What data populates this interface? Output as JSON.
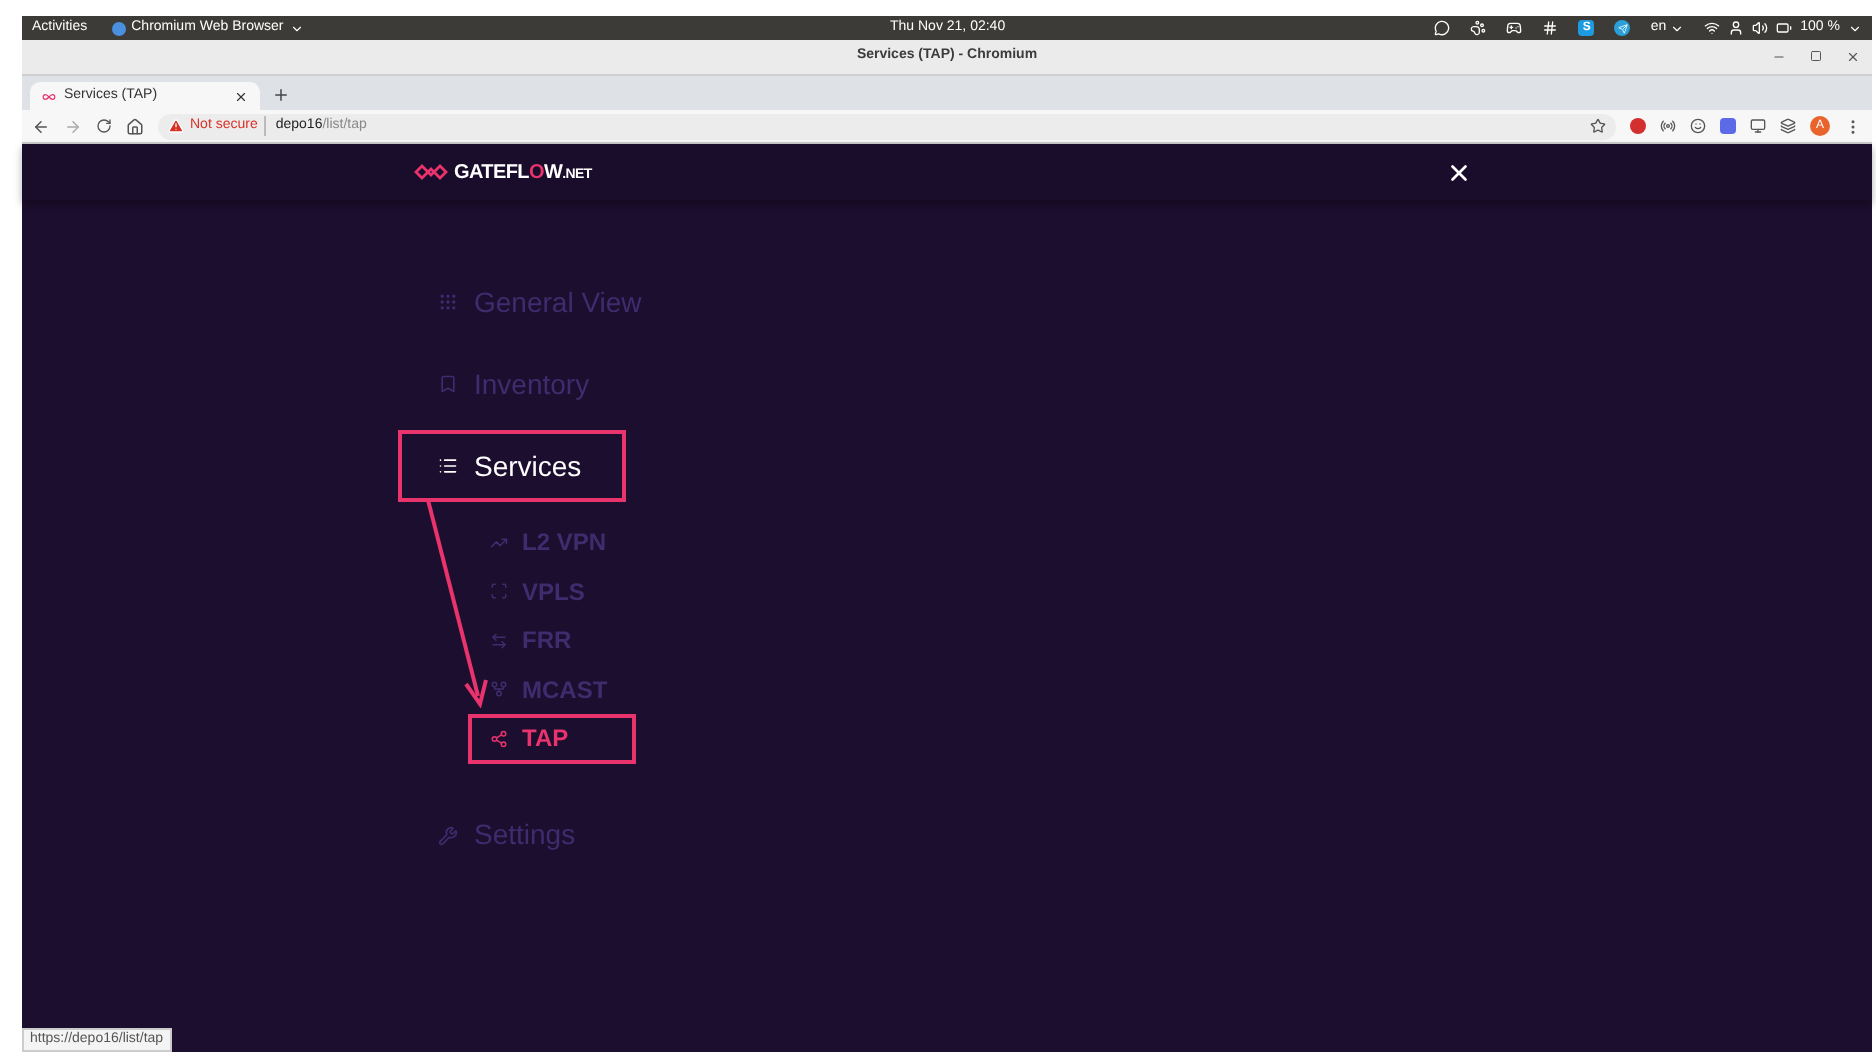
{
  "top_bar": {
    "activities": "Activities",
    "app_menu": "Chromium Web Browser",
    "clock": "Thu Nov 21, 02:40",
    "skype_letter": "S",
    "keyboard": "en",
    "battery": "100 %"
  },
  "window": {
    "title": "Services (TAP) - Chromium"
  },
  "tabs": [
    {
      "label": "Services (TAP)",
      "selected": true
    }
  ],
  "address_bar": {
    "security": "Not secure",
    "host": "depo16",
    "path": "/list/tap",
    "profile_letter": "A"
  },
  "app": {
    "logo": [
      {
        "text": "GATEFL",
        "accent": false,
        "small": false
      },
      {
        "text": "O",
        "accent": true,
        "small": false
      },
      {
        "text": "W",
        "accent": false,
        "small": false
      },
      {
        "text": ".NET",
        "accent": false,
        "small": true
      }
    ],
    "menu": [
      {
        "label": "General View",
        "selected": false,
        "annotated": false
      },
      {
        "label": "Inventory",
        "selected": false,
        "annotated": false
      },
      {
        "label": "Services",
        "selected": true,
        "annotated": true,
        "expanded": true,
        "children": [
          {
            "label": "L2 VPN",
            "selected": false,
            "annotated": false
          },
          {
            "label": "VPLS",
            "selected": false,
            "annotated": false
          },
          {
            "label": "FRR",
            "selected": false,
            "annotated": false
          },
          {
            "label": "MCAST",
            "selected": false,
            "annotated": false
          },
          {
            "label": "TAP",
            "selected": true,
            "annotated": true
          }
        ]
      },
      {
        "label": "Settings",
        "selected": false,
        "annotated": false
      }
    ]
  },
  "status_bar": {
    "url": "https://depo16/list/tap"
  }
}
